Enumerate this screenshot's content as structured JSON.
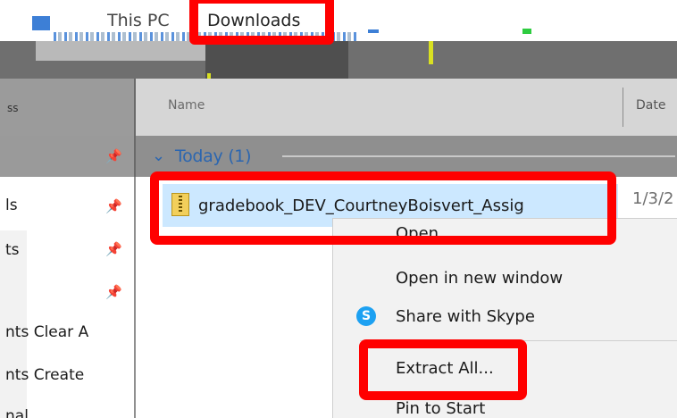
{
  "address_bar": {
    "this_pc": "This PC",
    "downloads": "Downloads"
  },
  "column_headers": {
    "name": "Name",
    "date": "Date"
  },
  "group": {
    "today": "Today (1)"
  },
  "nav_items": [
    {
      "label": "ls"
    },
    {
      "label": "ts"
    },
    {
      "label": ""
    },
    {
      "label": "nts Clear A"
    },
    {
      "label": "nts Create"
    },
    {
      "label": "nal"
    }
  ],
  "nav_header_text": "ss",
  "file": {
    "name": "gradebook_DEV_CourtneyBoisvert_Assig",
    "date": "1/3/2"
  },
  "context_menu": {
    "items": [
      {
        "label": "Open"
      },
      {
        "label": "Open in new window"
      },
      {
        "label": "Share with Skype"
      },
      {
        "label": "Extract All..."
      },
      {
        "label": "Pin to Start"
      }
    ],
    "skype_glyph": "S"
  },
  "colors": {
    "annotation": "#ff0000",
    "selection": "#cce8ff",
    "group_header": "#2b66b0"
  }
}
